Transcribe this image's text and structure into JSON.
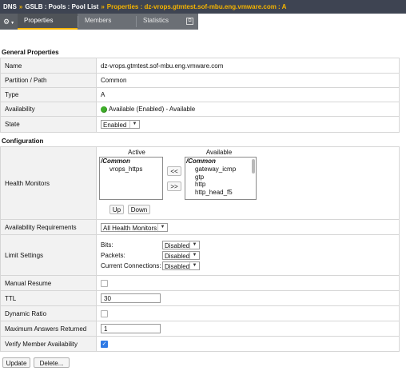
{
  "breadcrumb": {
    "items": [
      "DNS",
      "GSLB : Pools : Pool List"
    ],
    "separator": "»",
    "current": "Properties : dz-vrops.gtmtest.sof-mbu.eng.vmware.com : A"
  },
  "tabs": {
    "gear_icon": "⚙",
    "items": [
      {
        "label": "Properties",
        "active": true
      },
      {
        "label": "Members",
        "active": false
      },
      {
        "label": "Statistics",
        "active": false
      }
    ],
    "popout_icon": "⧉"
  },
  "general": {
    "title": "General Properties",
    "rows": [
      {
        "label": "Name",
        "value": "dz-vrops.gtmtest.sof-mbu.eng.vmware.com"
      },
      {
        "label": "Partition / Path",
        "value": "Common"
      },
      {
        "label": "Type",
        "value": "A"
      },
      {
        "label": "Availability",
        "value": "Available (Enabled) - Available"
      },
      {
        "label": "State",
        "value": "Enabled"
      }
    ]
  },
  "configuration": {
    "title": "Configuration",
    "health_monitors": {
      "label": "Health Monitors",
      "active_title": "Active",
      "available_title": "Available",
      "active_group": "/Common",
      "active_items": [
        "vrops_https"
      ],
      "available_group": "/Common",
      "available_items": [
        "gateway_icmp",
        "gtp",
        "http",
        "http_head_f5"
      ],
      "add_label": "<<",
      "remove_label": ">>",
      "up_label": "Up",
      "down_label": "Down"
    },
    "availability_requirements": {
      "label": "Availability Requirements",
      "value": "All Health Monitors"
    },
    "limit_settings": {
      "label": "Limit Settings",
      "rows": [
        {
          "label": "Bits:",
          "value": "Disabled"
        },
        {
          "label": "Packets:",
          "value": "Disabled"
        },
        {
          "label": "Current Connections:",
          "value": "Disabled"
        }
      ]
    },
    "manual_resume": {
      "label": "Manual Resume",
      "checked": false
    },
    "ttl": {
      "label": "TTL",
      "value": "30"
    },
    "dynamic_ratio": {
      "label": "Dynamic Ratio",
      "checked": false
    },
    "max_answers": {
      "label": "Maximum Answers Returned",
      "value": "1"
    },
    "verify_member": {
      "label": "Verify Member Availability",
      "checked": true
    }
  },
  "actions": {
    "update_label": "Update",
    "delete_label": "Delete..."
  },
  "colors": {
    "topbar": "#3e4452",
    "accent": "#f5b400",
    "status_green": "#3fae2a",
    "checkbox_blue": "#2f7ae5"
  }
}
